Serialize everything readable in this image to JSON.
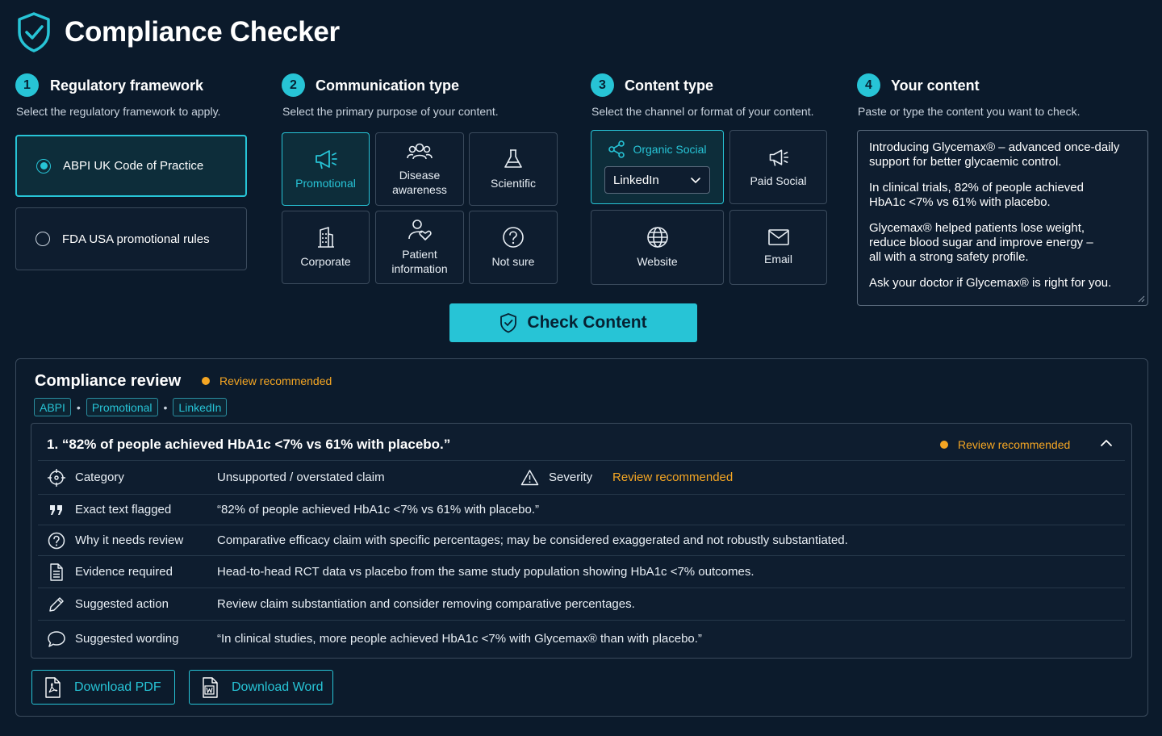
{
  "app": {
    "title": "Compliance Checker",
    "logo_icon": "shield-check-icon"
  },
  "colors": {
    "accent": "#27c4d6",
    "warning": "#f5a623",
    "background": "#0b1a2b"
  },
  "steps": [
    {
      "number": "1",
      "title": "Regulatory framework",
      "subtitle": "Select the regulatory framework to apply."
    },
    {
      "number": "2",
      "title": "Communication type",
      "subtitle": "Select the primary purpose of your content."
    },
    {
      "number": "3",
      "title": "Content type",
      "subtitle": "Select the channel or format of your content."
    },
    {
      "number": "4",
      "title": "Your content",
      "subtitle": "Paste or type the content you want to check."
    }
  ],
  "frameworks": [
    {
      "label": "ABPI UK Code of Practice",
      "selected": true
    },
    {
      "label": "FDA USA promotional rules",
      "selected": false
    }
  ],
  "communication_types": [
    {
      "label": "Promotional",
      "icon": "megaphone-icon",
      "selected": true
    },
    {
      "label": "Disease\nawareness",
      "icon": "people-group-icon",
      "selected": false
    },
    {
      "label": "Scientific",
      "icon": "flask-icon",
      "selected": false
    },
    {
      "label": "Corporate",
      "icon": "building-icon",
      "selected": false
    },
    {
      "label": "Patient\ninformation",
      "icon": "patient-heart-icon",
      "selected": false
    },
    {
      "label": "Not sure",
      "icon": "question-circle-icon",
      "selected": false
    }
  ],
  "content_types": [
    {
      "label": "Organic Social",
      "icon": "share-nodes-icon",
      "selected": true,
      "select_value": "LinkedIn"
    },
    {
      "label": "Paid Social",
      "icon": "megaphone-icon",
      "selected": false
    },
    {
      "label": "Website",
      "icon": "globe-icon",
      "selected": false
    },
    {
      "label": "Email",
      "icon": "envelope-icon",
      "selected": false
    }
  ],
  "content": {
    "paragraphs": [
      "Introducing Glycemax® – advanced once-daily\nsupport for better glycaemic control.",
      "In clinical trials, 82% of people achieved\nHbA1c <7% vs 61% with placebo.",
      "Glycemax® helped patients lose weight,\nreduce blood sugar and improve energy –\nall with a strong safety profile.",
      "Ask your doctor if Glycemax® is right for you."
    ]
  },
  "check_button": {
    "label": "Check Content"
  },
  "review": {
    "title": "Compliance review",
    "status": "Review recommended",
    "chips": [
      "ABPI",
      "Promotional",
      "LinkedIn"
    ],
    "chip_separator": "•",
    "issue": {
      "title": "1. “82% of people achieved HbA1c <7% vs 61% with placebo.”",
      "status": "Review recommended",
      "category_label": "Category",
      "category_value": "Unsupported / overstated claim",
      "severity_label": "Severity",
      "severity_value": "Review recommended",
      "rows": [
        {
          "label": "Exact text flagged",
          "value": "“82% of people achieved HbA1c <7% vs 61% with placebo.”",
          "icon": "quote-icon"
        },
        {
          "label": "Why it needs review",
          "value": "Comparative efficacy claim with specific percentages; may be considered exaggerated and not robustly substantiated.",
          "icon": "question-circle-icon"
        },
        {
          "label": "Evidence required",
          "value": "Head-to-head RCT data vs placebo from the same study population showing HbA1c <7% outcomes.",
          "icon": "document-icon"
        },
        {
          "label": "Suggested action",
          "value": "Review claim substantiation and consider removing comparative percentages.",
          "icon": "pencil-icon"
        },
        {
          "label": "Suggested wording",
          "value": "“In clinical studies, more people achieved HbA1c <7% with Glycemax® than with placebo.”",
          "icon": "speech-bubble-icon"
        }
      ]
    },
    "downloads": [
      {
        "label": "Download PDF",
        "icon": "pdf-file-icon"
      },
      {
        "label": "Download Word",
        "icon": "word-file-icon"
      }
    ]
  }
}
